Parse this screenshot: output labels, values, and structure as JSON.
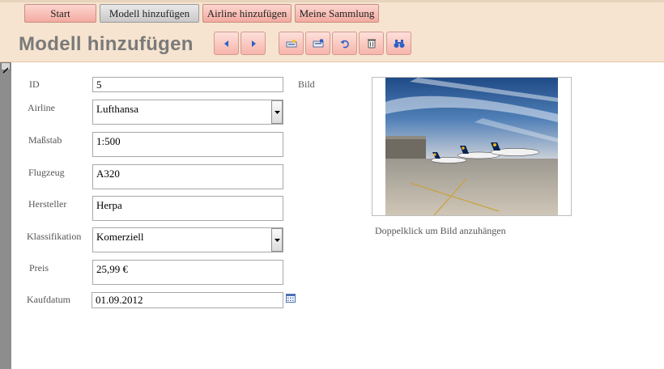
{
  "nav": {
    "tabs": [
      {
        "label": "Start",
        "active": false
      },
      {
        "label": "Modell hinzufügen",
        "active": true
      },
      {
        "label": "Airline hinzufügen",
        "active": false
      },
      {
        "label": "Meine Sammlung",
        "active": false
      }
    ]
  },
  "header": {
    "title": "Modell hinzufügen"
  },
  "toolbar": {
    "buttons": [
      {
        "icon": "arrow-left-icon"
      },
      {
        "icon": "arrow-right-icon"
      },
      {
        "icon": "new-record-icon"
      },
      {
        "icon": "save-record-icon"
      },
      {
        "icon": "undo-icon"
      },
      {
        "icon": "delete-icon"
      },
      {
        "icon": "find-binoculars-icon"
      }
    ]
  },
  "form": {
    "id": {
      "label": "ID",
      "value": "5"
    },
    "airline": {
      "label": "Airline",
      "value": "Lufthansa"
    },
    "massstab": {
      "label": "Maßstab",
      "value": "1:500"
    },
    "flugzeug": {
      "label": "Flugzeug",
      "value": "A320"
    },
    "hersteller": {
      "label": "Hersteller",
      "value": "Herpa"
    },
    "klassifikation": {
      "label": "Klassifikation",
      "value": "Komerziell"
    },
    "preis": {
      "label": "Preis",
      "value": "25,99 €"
    },
    "kaufdatum": {
      "label": "Kaufdatum",
      "value": "01.09.2012"
    },
    "bild": {
      "label": "Bild"
    }
  },
  "image": {
    "caption": "Doppelklick um Bild anzuhängen"
  },
  "colors": {
    "header_bg": "#f6e4d0",
    "button_pink": "#f3aaa0",
    "active_tab_gray": "#c9c9c9",
    "toolbar_icon_blue": "#2d5fc8"
  }
}
